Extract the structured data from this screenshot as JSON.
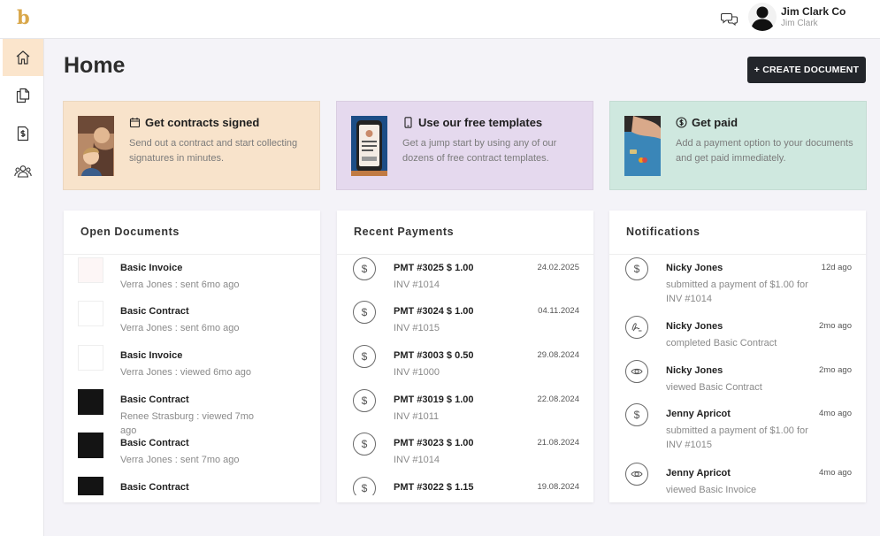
{
  "header": {
    "logo": "b",
    "chat_icon": "chat-bubbles-icon",
    "user_company": "Jim Clark Co",
    "user_name": "Jim Clark"
  },
  "sidebar": {
    "items": [
      {
        "name": "home",
        "icon": "home-icon",
        "active": true
      },
      {
        "name": "documents",
        "icon": "documents-icon",
        "active": false
      },
      {
        "name": "payments",
        "icon": "invoice-dollar-icon",
        "active": false
      },
      {
        "name": "contacts",
        "icon": "people-icon",
        "active": false
      }
    ]
  },
  "page": {
    "title": "Home",
    "create_button": "+ CREATE DOCUMENT"
  },
  "promos": [
    {
      "title": "Get contracts signed",
      "icon": "calendar-icon",
      "desc": "Send out a contract and start collecting signatures in minutes.",
      "bg": "#f8e3cb"
    },
    {
      "title": "Use our free templates",
      "icon": "phone-icon",
      "desc": "Get a jump start by using any of our dozens of free contract templates.",
      "bg": "#e5d9ee"
    },
    {
      "title": "Get paid",
      "icon": "dollar-circle-icon",
      "desc": "Add a payment option to your documents and get paid immediately.",
      "bg": "#cfe8df"
    }
  ],
  "open_documents": {
    "title": "Open Documents",
    "items": [
      {
        "title": "Basic Invoice",
        "sub": "Verra Jones : sent 6mo ago",
        "thumb": "light"
      },
      {
        "title": "Basic Contract",
        "sub": "Verra Jones : sent 6mo ago",
        "thumb": "blank"
      },
      {
        "title": "Basic Invoice",
        "sub": "Verra Jones : viewed 6mo ago",
        "thumb": "blank"
      },
      {
        "title": "Basic Contract",
        "sub": "Renee Strasburg : viewed 7mo ago",
        "thumb": "dark"
      },
      {
        "title": "Basic Contract",
        "sub": "Verra Jones : sent 7mo ago",
        "thumb": "dark"
      },
      {
        "title": "Basic Contract",
        "sub": "",
        "thumb": "dark"
      }
    ]
  },
  "recent_payments": {
    "title": "Recent Payments",
    "items": [
      {
        "title": "PMT #3025 $ 1.00",
        "sub": "INV #1014",
        "date": "24.02.2025"
      },
      {
        "title": "PMT #3024 $ 1.00",
        "sub": "INV #1015",
        "date": "04.11.2024"
      },
      {
        "title": "PMT #3003 $ 0.50",
        "sub": "INV #1000",
        "date": "29.08.2024"
      },
      {
        "title": "PMT #3019 $ 1.00",
        "sub": "INV #1011",
        "date": "22.08.2024"
      },
      {
        "title": "PMT #3023 $ 1.00",
        "sub": "INV #1014",
        "date": "21.08.2024"
      },
      {
        "title": "PMT #3022 $ 1.15",
        "sub": "",
        "date": "19.08.2024"
      }
    ]
  },
  "notifications": {
    "title": "Notifications",
    "items": [
      {
        "title": "Nicky Jones",
        "sub": "submitted a payment of $1.00 for INV #1014",
        "time": "12d ago",
        "icon": "dollar-circle-icon"
      },
      {
        "title": "Nicky Jones",
        "sub": "completed Basic Contract",
        "time": "2mo ago",
        "icon": "signature-icon"
      },
      {
        "title": "Nicky Jones",
        "sub": "viewed Basic Contract",
        "time": "2mo ago",
        "icon": "eye-icon"
      },
      {
        "title": "Jenny Apricot",
        "sub": "submitted a payment of $1.00 for INV #1015",
        "time": "4mo ago",
        "icon": "dollar-circle-icon"
      },
      {
        "title": "Jenny Apricot",
        "sub": "viewed Basic Invoice",
        "time": "4mo ago",
        "icon": "eye-icon"
      }
    ]
  }
}
